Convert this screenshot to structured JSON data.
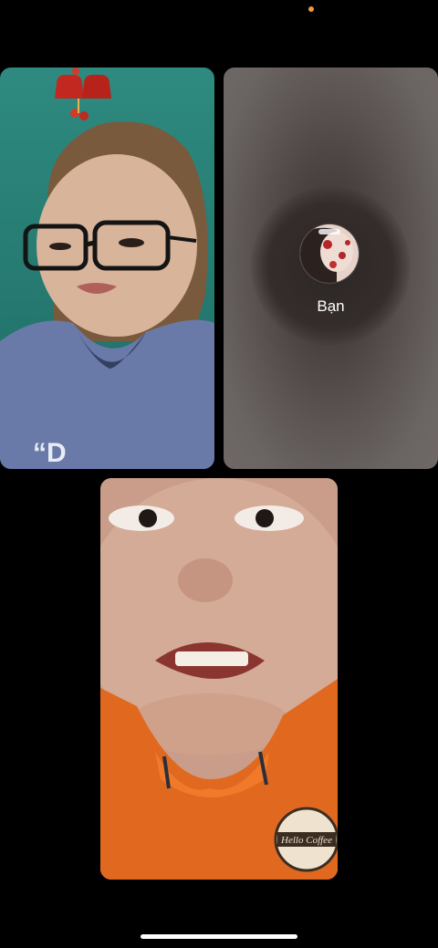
{
  "status_bar": {
    "indicator_color": "#f19a3e"
  },
  "participants": [
    {
      "id": "participant-1",
      "video": "on"
    },
    {
      "id": "participant-self",
      "video": "off",
      "name": "Bạn",
      "avatar_icon": "profile-avatar"
    },
    {
      "id": "participant-3",
      "video": "on"
    }
  ],
  "colors": {
    "background": "#000000",
    "self_tile": "#5b5452",
    "text": "#ffffff"
  }
}
